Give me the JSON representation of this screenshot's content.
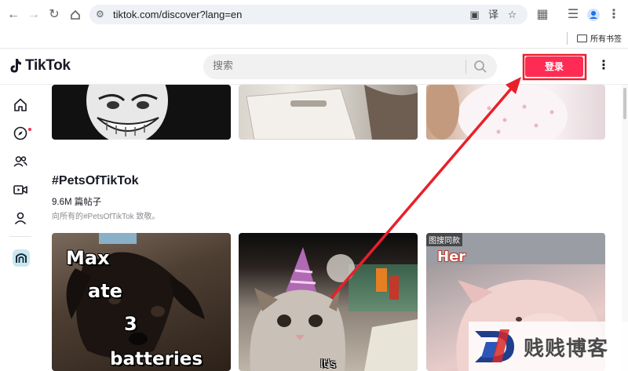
{
  "browser": {
    "url": "tiktok.com/discover?lang=en",
    "bookmarks_label": "所有书签"
  },
  "header": {
    "logo_text": "TikTok",
    "search_placeholder": "搜索",
    "login_label": "登录"
  },
  "hashtag": {
    "title": "#PetsOfTikTok",
    "post_count": "9.6M 篇帖子",
    "description": "向所有的#PetsOfTikTok 致敬。"
  },
  "videos": {
    "dog_caption_1": "Max",
    "dog_caption_2": "ate",
    "dog_caption_3": "3",
    "dog_caption_4": "batteries",
    "cat_caption": "It's",
    "pig_badge": "图搜同款",
    "pig_caption": "Her"
  },
  "watermark": {
    "text": "贱贱博客"
  },
  "colors": {
    "accent": "#fe2c55",
    "annotation": "#e8202a"
  }
}
